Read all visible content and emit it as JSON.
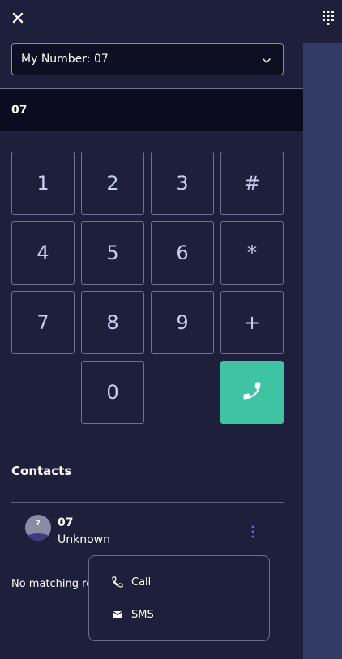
{
  "header": {
    "close_icon": "close-icon",
    "dialpad_icon": "dialpad-grid-icon"
  },
  "number_select": {
    "label": "My Number: 07",
    "icon": "chevron-down-icon"
  },
  "dial_display": {
    "value": "07"
  },
  "keypad": {
    "keys": [
      "1",
      "2",
      "3",
      "#",
      "4",
      "5",
      "6",
      "*",
      "7",
      "8",
      "9",
      "+",
      "0"
    ],
    "call_icon": "phone-icon",
    "call_color": "#3ec3a3"
  },
  "contacts": {
    "heading": "Contacts",
    "items": [
      {
        "name": "07",
        "subtitle": "Unknown",
        "avatar_glyph": "?"
      }
    ],
    "no_match_text": "No matching re"
  },
  "context_menu": {
    "items": [
      {
        "label": "Call",
        "icon": "phone-outline-icon"
      },
      {
        "label": "SMS",
        "icon": "envelope-icon"
      }
    ]
  },
  "colors": {
    "background": "#1e1f3a",
    "side_strip": "#323a66",
    "accent": "#3ec3a3",
    "kebab": "#6f5fd8"
  }
}
